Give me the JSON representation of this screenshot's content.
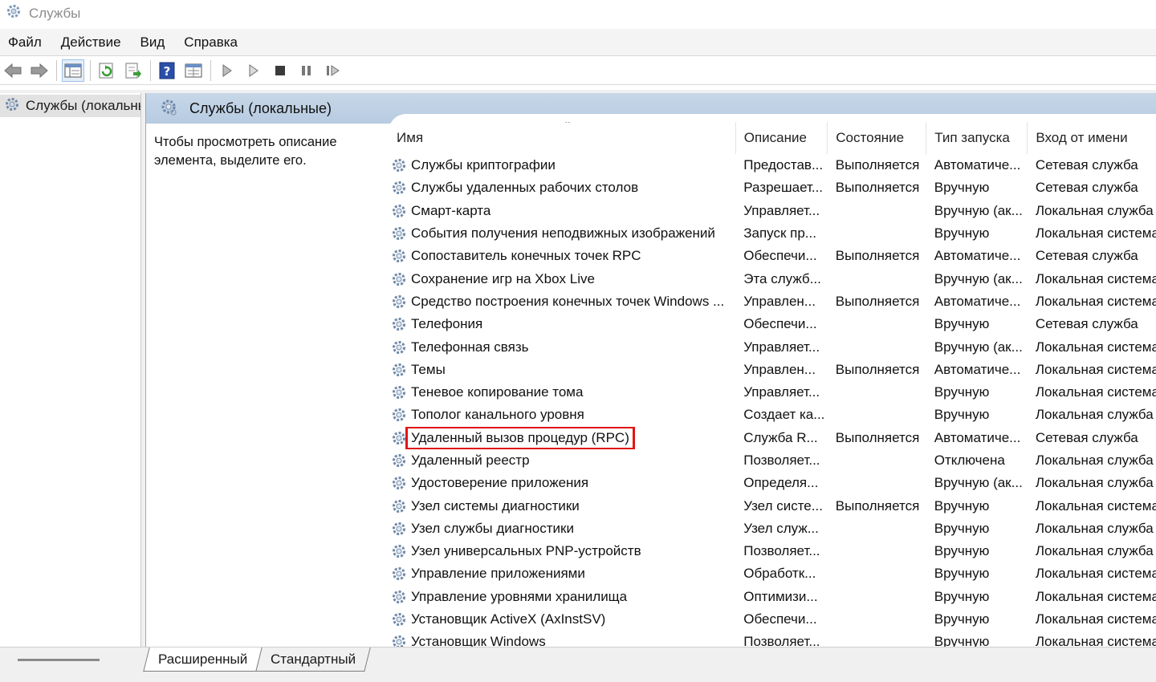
{
  "window": {
    "title": "Службы"
  },
  "menu": [
    "Файл",
    "Действие",
    "Вид",
    "Справка"
  ],
  "toolbar": {
    "buttons": [
      "back-arrow-icon",
      "forward-arrow-icon",
      "console-tree-icon",
      "refresh-icon",
      "export-list-icon",
      "help-icon",
      "properties-icon",
      "start-service-icon",
      "start-service-alt-icon",
      "stop-service-icon",
      "pause-service-icon",
      "restart-service-icon"
    ]
  },
  "tree": {
    "item": "Службы (локальные)"
  },
  "content": {
    "header": "Службы (локальные)",
    "description_hint": "Чтобы просмотреть описание элемента, выделите его."
  },
  "table": {
    "columns": [
      "Имя",
      "Описание",
      "Состояние",
      "Тип запуска",
      "Вход от имени"
    ],
    "highlighted_row": "Удаленный вызов процедур (RPC)",
    "rows": [
      [
        "Службы криптографии",
        "Предостав...",
        "Выполняется",
        "Автоматиче...",
        "Сетевая служба"
      ],
      [
        "Службы удаленных рабочих столов",
        "Разрешает...",
        "Выполняется",
        "Вручную",
        "Сетевая служба"
      ],
      [
        "Смарт-карта",
        "Управляет...",
        "",
        "Вручную (ак...",
        "Локальная служба"
      ],
      [
        "События получения неподвижных изображений",
        "Запуск пр...",
        "",
        "Вручную",
        "Локальная система"
      ],
      [
        "Сопоставитель конечных точек RPC",
        "Обеспечи...",
        "Выполняется",
        "Автоматиче...",
        "Сетевая служба"
      ],
      [
        "Сохранение игр на Xbox Live",
        "Эта служб...",
        "",
        "Вручную (ак...",
        "Локальная система"
      ],
      [
        "Средство построения конечных точек Windows ...",
        "Управлен...",
        "Выполняется",
        "Автоматиче...",
        "Локальная система"
      ],
      [
        "Телефония",
        "Обеспечи...",
        "",
        "Вручную",
        "Сетевая служба"
      ],
      [
        "Телефонная связь",
        "Управляет...",
        "",
        "Вручную (ак...",
        "Локальная система"
      ],
      [
        "Темы",
        "Управлен...",
        "Выполняется",
        "Автоматиче...",
        "Локальная система"
      ],
      [
        "Теневое копирование тома",
        "Управляет...",
        "",
        "Вручную",
        "Локальная система"
      ],
      [
        "Тополог канального уровня",
        "Создает ка...",
        "",
        "Вручную",
        "Локальная служба"
      ],
      [
        "Удаленный вызов процедур (RPC)",
        "Служба R...",
        "Выполняется",
        "Автоматиче...",
        "Сетевая служба"
      ],
      [
        "Удаленный реестр",
        "Позволяет...",
        "",
        "Отключена",
        "Локальная служба"
      ],
      [
        "Удостоверение приложения",
        "Определя...",
        "",
        "Вручную (ак...",
        "Локальная служба"
      ],
      [
        "Узел системы диагностики",
        "Узел систе...",
        "Выполняется",
        "Вручную",
        "Локальная система"
      ],
      [
        "Узел службы диагностики",
        "Узел служ...",
        "",
        "Вручную",
        "Локальная служба"
      ],
      [
        "Узел универсальных PNP-устройств",
        "Позволяет...",
        "",
        "Вручную",
        "Локальная служба"
      ],
      [
        "Управление приложениями",
        "Обработк...",
        "",
        "Вручную",
        "Локальная система"
      ],
      [
        "Управление уровнями хранилища",
        "Оптимизи...",
        "",
        "Вручную",
        "Локальная система"
      ],
      [
        "Установщик ActiveX (AxInstSV)",
        "Обеспечи...",
        "",
        "Вручную",
        "Локальная система"
      ],
      [
        "Установщик Windows",
        "Позволяет...",
        "",
        "Вручную",
        "Локальная система"
      ]
    ]
  },
  "tabs": [
    "Расширенный",
    "Стандартный"
  ],
  "colors": {
    "header_bg": "#b7cbe1",
    "highlight": "#e01515",
    "gear": "#6f8aa8"
  }
}
